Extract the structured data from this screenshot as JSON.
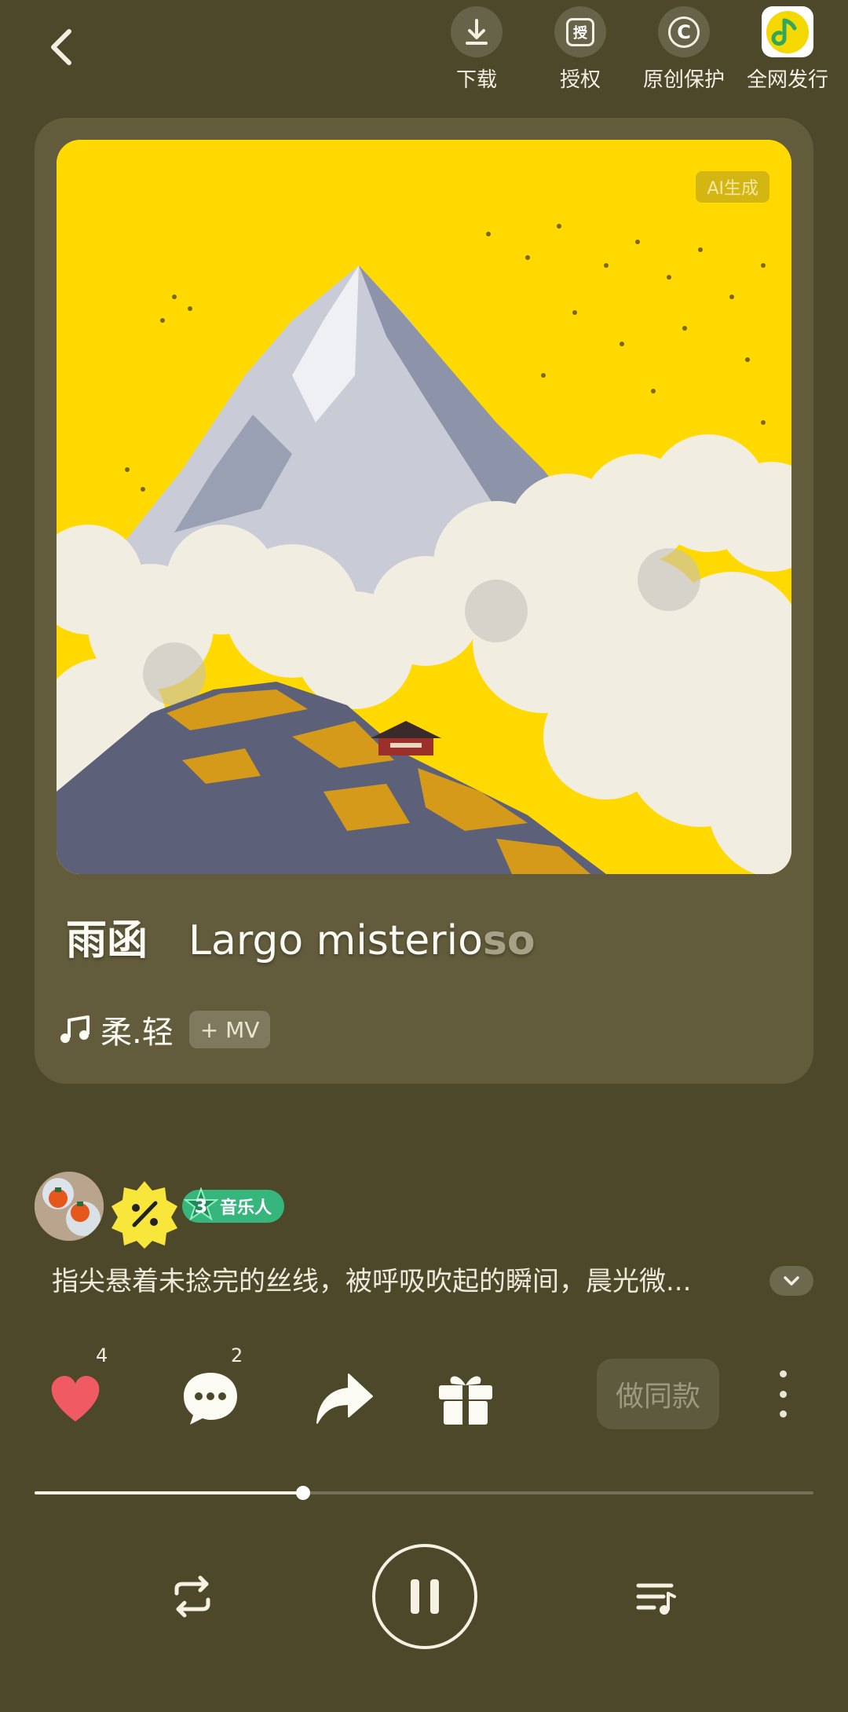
{
  "top_actions": [
    {
      "label": "下载",
      "icon": "download-icon"
    },
    {
      "label": "授权",
      "icon": "license-icon",
      "glyph": "授"
    },
    {
      "label": "原创保护",
      "icon": "copyright-icon",
      "glyph": "C"
    },
    {
      "label": "全网发行",
      "icon": "qq-music-icon"
    }
  ],
  "cover": {
    "ai_badge": "AI生成"
  },
  "song": {
    "title_cn": "雨函",
    "title_en_main": "Largo misterio",
    "title_en_fade": "so",
    "style": "柔.轻",
    "mv_chip": "+ MV"
  },
  "creator": {
    "level": "3",
    "level_label": "音乐人",
    "description": "指尖悬着未捻完的丝线，被呼吸吹起的瞬间，晨光微..."
  },
  "actions": {
    "likes": "4",
    "comments": "2",
    "same_label": "做同款"
  },
  "player": {
    "progress": 0.345
  },
  "colors": {
    "background": "#4c4829",
    "card": "#625c3c",
    "cover_sky": "#ffd900",
    "like": "#f05a62",
    "level_badge": "#36b57d"
  }
}
